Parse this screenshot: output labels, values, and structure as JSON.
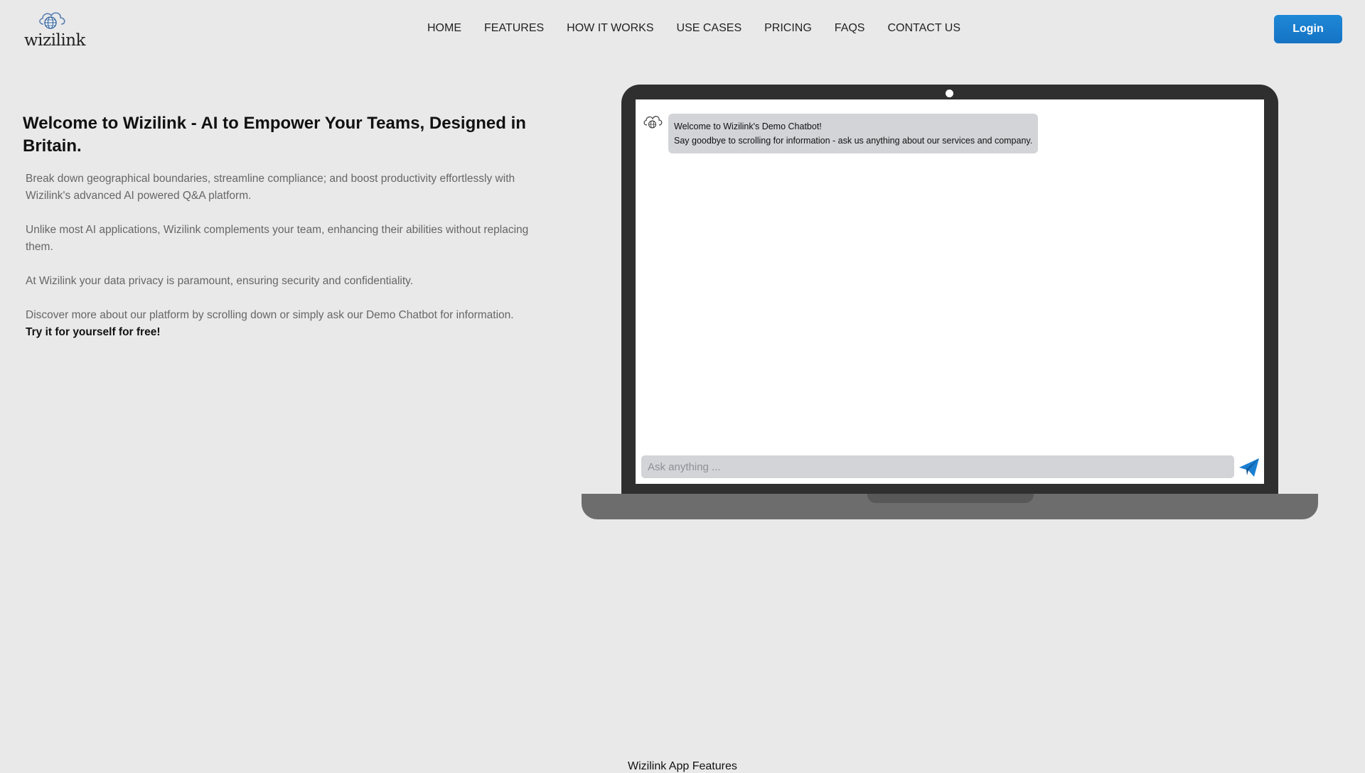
{
  "brand": {
    "name": "wizilink",
    "icon": "cloud-globe-icon",
    "accent": "#1a7fd0"
  },
  "nav": {
    "items": [
      {
        "label": "HOME"
      },
      {
        "label": "FEATURES"
      },
      {
        "label": "HOW IT WORKS"
      },
      {
        "label": "USE CASES"
      },
      {
        "label": "PRICING"
      },
      {
        "label": "FAQS"
      },
      {
        "label": "CONTACT US"
      }
    ],
    "login_label": "Login"
  },
  "hero": {
    "title": "Welcome to Wizilink - AI to Empower Your Teams, Designed in Britain.",
    "paragraphs": [
      "Break down geographical boundaries, streamline compliance; and boost productivity effortlessly with Wizilink's advanced AI powered Q&A platform.",
      "Unlike most AI applications, Wizilink complements your team, enhancing their abilities without replacing them.",
      "At Wizilink your data privacy is paramount, ensuring security and confidentiality.",
      "Discover more about our platform by scrolling down or simply ask our Demo Chatbot for information."
    ],
    "cta_text": "Try it for yourself for free!"
  },
  "chatbot": {
    "messages": [
      {
        "sender": "bot",
        "lines": [
          "Welcome to Wizilink's Demo Chatbot!",
          "Say goodbye to scrolling for information - ask us anything about our services and company."
        ]
      }
    ],
    "input_placeholder": "Ask anything ...",
    "input_value": "",
    "send_icon": "paper-plane-icon"
  },
  "next_section": {
    "title": "Wizilink App Features"
  }
}
